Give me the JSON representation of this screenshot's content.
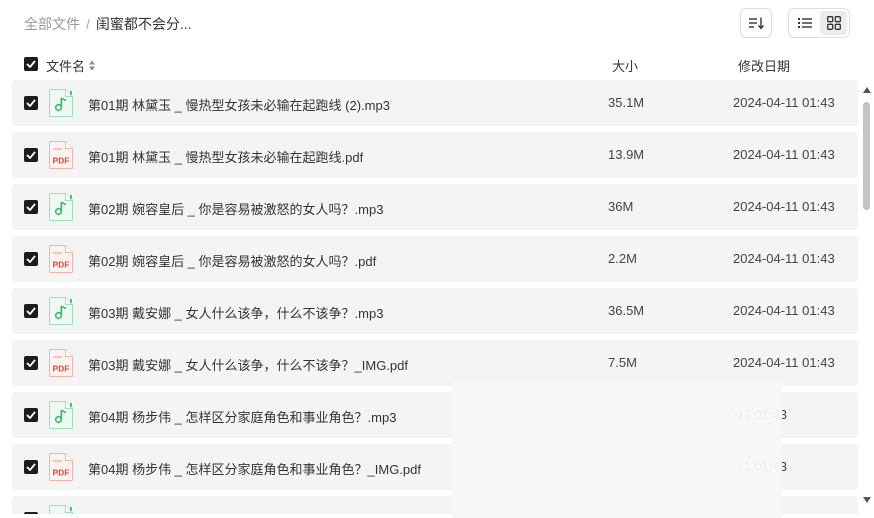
{
  "breadcrumb": {
    "root": "全部文件",
    "separator": "/",
    "current": "闺蜜都不会分..."
  },
  "toolbar": {
    "sort_icon": "sort-icon",
    "list_view_icon": "list-view-icon",
    "grid_view_icon": "grid-view-icon",
    "active_view": "grid"
  },
  "table": {
    "headers": {
      "name": "文件名",
      "size": "大小",
      "date": "修改日期"
    },
    "rows": [
      {
        "type": "mp3",
        "name": "第01期 林黛玉 _ 慢热型女孩未必输在起跑线 (2).mp3",
        "size": "35.1M",
        "date": "2024-04-11 01:43"
      },
      {
        "type": "pdf",
        "name": "第01期 林黛玉 _ 慢热型女孩未必输在起跑线.pdf",
        "size": "13.9M",
        "date": "2024-04-11 01:43"
      },
      {
        "type": "mp3",
        "name": "第02期 婉容皇后 _ 你是容易被激怒的女人吗？.mp3",
        "size": "36M",
        "date": "2024-04-11 01:43"
      },
      {
        "type": "pdf",
        "name": "第02期 婉容皇后 _ 你是容易被激怒的女人吗？.pdf",
        "size": "2.2M",
        "date": "2024-04-11 01:43"
      },
      {
        "type": "mp3",
        "name": "第03期 戴安娜 _ 女人什么该争，什么不该争？.mp3",
        "size": "36.5M",
        "date": "2024-04-11 01:43"
      },
      {
        "type": "pdf",
        "name": "第03期 戴安娜 _ 女人什么该争，什么不该争？_IMG.pdf",
        "size": "7.5M",
        "date": "2024-04-11 01:43"
      },
      {
        "type": "mp3",
        "name": "第04期 杨步伟 _ 怎样区分家庭角色和事业角色？.mp3",
        "size": "",
        "date": "-11 01:43"
      },
      {
        "type": "pdf",
        "name": "第04期 杨步伟 _ 怎样区分家庭角色和事业角色？_IMG.pdf",
        "size": "",
        "date": "-11 01:43"
      },
      {
        "type": "mp3",
        "name": "",
        "size": "",
        "date": ""
      }
    ]
  },
  "colors": {
    "row_bg": "#f4f4f4",
    "checkbox": "#1c1c1c",
    "mp3_accent": "#2ebd6a",
    "pdf_accent": "#e0453a"
  },
  "icons": {
    "mp3": "music-file-icon",
    "pdf": "pdf-file-icon"
  },
  "pdf_icon_text": "PDF"
}
